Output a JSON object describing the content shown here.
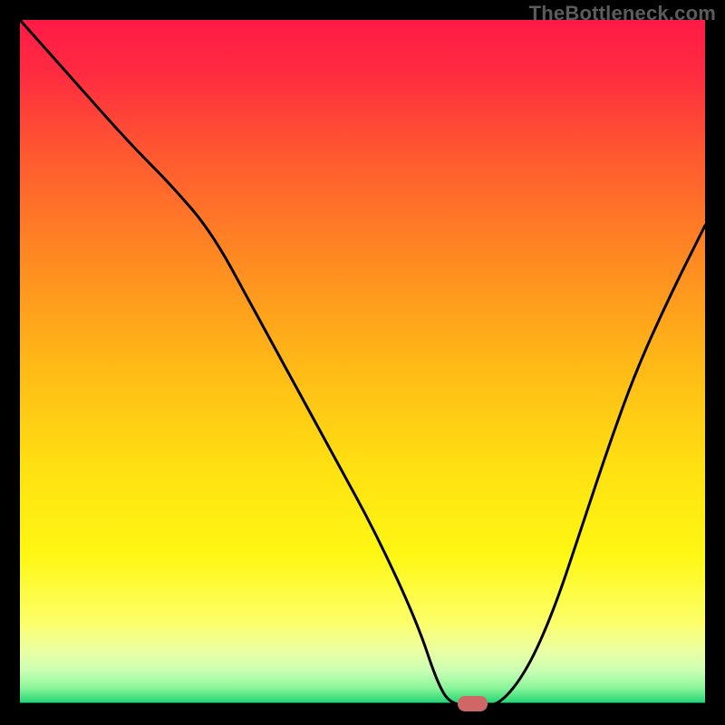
{
  "watermark": "TheBottleneck.com",
  "chart_data": {
    "type": "line",
    "title": "",
    "xlabel": "",
    "ylabel": "",
    "xlim": [
      0,
      100
    ],
    "ylim": [
      0,
      100
    ],
    "grid": false,
    "legend": false,
    "background_gradient": {
      "stops": [
        {
          "offset": 0.0,
          "color": "#ff1a47"
        },
        {
          "offset": 0.08,
          "color": "#ff2c40"
        },
        {
          "offset": 0.2,
          "color": "#ff5a30"
        },
        {
          "offset": 0.35,
          "color": "#ff8a22"
        },
        {
          "offset": 0.5,
          "color": "#ffb817"
        },
        {
          "offset": 0.65,
          "color": "#ffe012"
        },
        {
          "offset": 0.78,
          "color": "#fff713"
        },
        {
          "offset": 0.88,
          "color": "#fcff6a"
        },
        {
          "offset": 0.92,
          "color": "#ecffa3"
        },
        {
          "offset": 0.95,
          "color": "#c9ffb4"
        },
        {
          "offset": 0.975,
          "color": "#8bf59a"
        },
        {
          "offset": 1.0,
          "color": "#11d06d"
        }
      ]
    },
    "baseline_y": 0,
    "series": [
      {
        "name": "bottleneck-curve",
        "color": "#000000",
        "x": [
          0,
          8,
          16,
          22,
          28,
          34,
          40,
          46,
          52,
          58,
          61,
          63,
          67,
          70,
          74,
          78,
          82,
          86,
          90,
          95,
          100
        ],
        "y": [
          100,
          91,
          82,
          76,
          69,
          58,
          47,
          36,
          25,
          12,
          3,
          0,
          0,
          0,
          5,
          14,
          26,
          38,
          49,
          60,
          70
        ]
      }
    ],
    "marker": {
      "x": 66,
      "y": 0,
      "color": "#cf6767"
    }
  }
}
